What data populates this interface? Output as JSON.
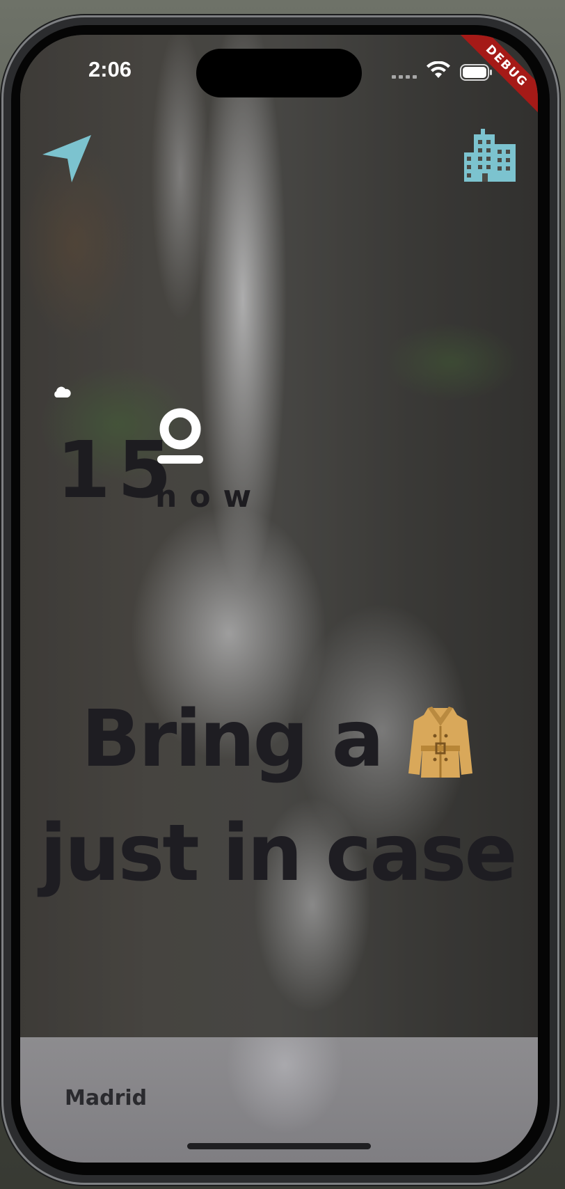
{
  "status_bar": {
    "time": "2:06"
  },
  "debug_banner": {
    "label": "DEBUG",
    "color": "#a51a17"
  },
  "header": {
    "left_icon": "navigation-arrow-icon",
    "right_icon": "city-building-icon",
    "icon_color": "#7cc3cf"
  },
  "weather": {
    "condition_icon": "cloud-icon",
    "temperature": "15",
    "degree_symbol": "o",
    "time_label": "now"
  },
  "message": {
    "line1": "Bring a",
    "line1_emoji": "coat-icon",
    "line2": "just in case"
  },
  "location": {
    "city": "Madrid"
  }
}
